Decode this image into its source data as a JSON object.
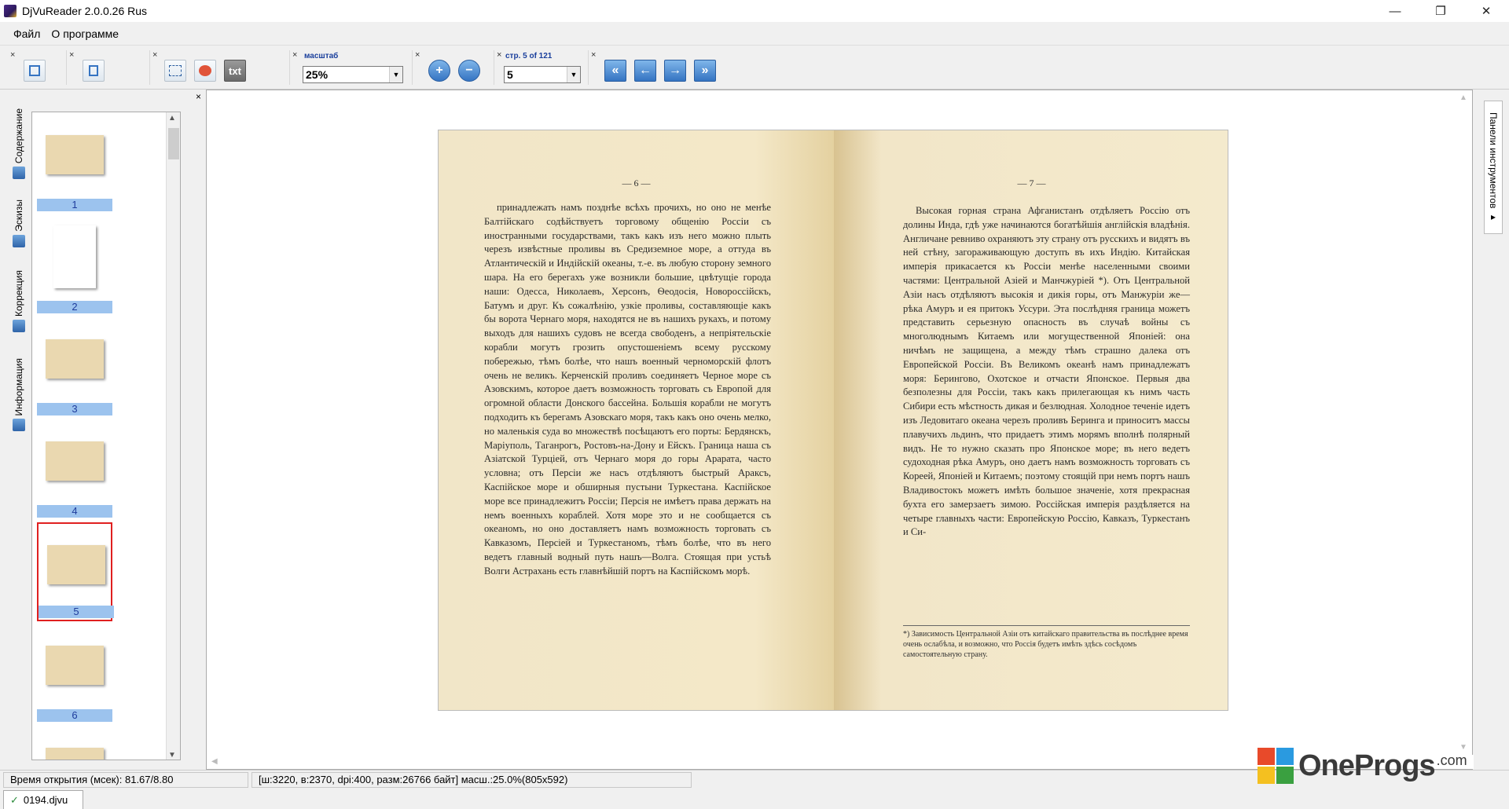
{
  "window": {
    "title": "DjVuReader 2.0.0.26 Rus",
    "controls": [
      "—",
      "❐",
      "✕"
    ]
  },
  "menu": [
    "Файл",
    "О программе"
  ],
  "toolbar": {
    "scale_label": "масштаб",
    "scale_value": "25%",
    "page_label": "стр. 5 of 121",
    "page_value": "5",
    "txt_label": "txt",
    "zoom_in": "+",
    "zoom_out": "−",
    "nav": [
      "«",
      "←",
      "→",
      "»"
    ],
    "close_glyph": "×"
  },
  "sidebar": {
    "close_glyph": "×",
    "tabs": [
      "Содержание",
      "Эскизы",
      "Коррекция",
      "Информация"
    ],
    "thumbnails": [
      {
        "num": "1"
      },
      {
        "num": "2"
      },
      {
        "num": "3"
      },
      {
        "num": "4"
      },
      {
        "num": "5"
      },
      {
        "num": "6"
      }
    ],
    "selected_page": "5"
  },
  "document": {
    "left_page_num": "— 6 —",
    "right_page_num": "— 7 —",
    "left_text": "принадлежать намъ позднѣе всѣхъ прочихъ, но оно не менѣе Балтійскаго содѣйствуетъ торговому общенію Россіи съ иностранными государствами, такъ какъ изъ него можно плыть черезъ извѣстные проливы въ Средиземное море, а оттуда въ Атлантическій и Индійскій океаны, т.-е. въ любую сторону земного шара. На его берегахъ уже возникли большие, цвѣтущіе города наши: Одесса, Николаевъ, Херсонъ, Ѳеодосія, Новороссійскъ, Батумъ и друг. Къ сожалѣнію, узкіе проливы, составляющіе какъ бы ворота Чернаго моря, находятся не въ нашихъ рукахъ, и потому выходъ для нашихъ судовъ не всегда свободенъ, а непріятельскіе корабли могутъ грозить опустошеніемъ всему русскому побережью, тѣмъ болѣе, что нашъ военный черноморскій флотъ очень не великъ. Керченскій проливъ соединяетъ Черное море съ Азовскимъ, которое даетъ возможность торговать съ Европой для огромной области Донского бассейна. Большія корабли не могутъ подходить къ берегамъ Азовскаго моря, такъ какъ оно очень мелко, но маленькія суда во множествѣ посѣщаютъ его порты: Бердянскъ, Маріуполь, Таганрогъ, Ростовъ-на-Дону и Ейскъ. Граница наша съ Азіатской Турціей, отъ Чернаго моря до горы Арарата, часто условна; отъ Персіи же насъ отдѣляютъ быстрый Араксъ, Каспійское море и обширныя пустыни Туркестана. Каспійское море все принадлежитъ Россіи; Персія не имѣетъ права держать на немъ военныхъ кораблей. Хотя море это и не сообщается съ океаномъ, но оно доставляетъ намъ возможность торговать съ Кавказомъ, Персіей и Туркестаномъ, тѣмъ болѣе, что въ него ведетъ главный водный путь нашъ—Волга. Стоящая при устьѣ Волги Астрахань есть главнѣйшій портъ на Каспійскомъ морѣ.",
    "right_text": "Высокая горная страна Афганистанъ отдѣляетъ Россію отъ долины Инда, гдѣ уже начинаются богатѣйшія англійскія владѣнія. Англичане ревниво охраняютъ эту страну отъ русскихъ и видятъ въ ней стѣну, загораживающую доступъ въ ихъ Индію. Китайская имперія прикасается къ Россіи менѣе населенными своими частями: Центральной Азіей и Манчжуріей *). Отъ Центральной Азіи насъ отдѣляютъ высокія и дикія горы, отъ Манжуріи же—рѣка Амуръ и ея притокъ Уссури. Эта послѣдняя граница можетъ представить серьезную опасность въ случаѣ войны съ многолюднымъ Китаемъ или могущественной Японіей: она ничѣмъ не защищена, а между тѣмъ страшно далека отъ Европейской Россіи. Въ Великомъ океанѣ намъ принадлежатъ моря: Берингово, Охотское и отчасти Японское. Первыя два безполезны для Россіи, такъ какъ прилегающая къ нимъ часть Сибири есть мѣстность дикая и безлюдная. Холодное теченіе идетъ изъ Ледовитаго океана черезъ проливъ Беринга и приноситъ массы плавучихъ льдинъ, что придаетъ этимъ морямъ вполнѣ полярный видъ. Не то нужно сказать про Японское море; въ него ведетъ судоходная рѣка Амуръ, оно даетъ намъ возможность торговать съ Кореей, Японіей и Китаемъ; поэтому стоящій при немъ портъ нашъ Владивостокъ можетъ имѣть большое значеніе, хотя прекрасная бухта его замерзаетъ зимою. Россійская имперія раздѣляется на четыре главныхъ части: Европейскую Россію, Кавказъ, Туркестанъ и Си-",
    "footnote": "*) Зависимость Центральной Азіи отъ китайскаго правительства въ послѣднее время очень ослабѣла, и возможно, что Россія будетъ имѣть здѣсь сосѣдомъ самостоятельную страну."
  },
  "right_strip": {
    "tab_label": "Панели инструментов ▸"
  },
  "status": {
    "open_time": "Время открытия (мсек): 81.67/8.80",
    "info": "[ш:3220, в:2370, dpi:400, разм:26766 байт] масш.:25.0%(805x592)"
  },
  "tabs": {
    "file": "0194.djvu",
    "check_glyph": "✓"
  },
  "watermark": {
    "name": "OneProgs",
    "suffix": ".com",
    "colors": [
      "#e84a2a",
      "#2a9ae0",
      "#f4c020",
      "#3aa040"
    ]
  }
}
